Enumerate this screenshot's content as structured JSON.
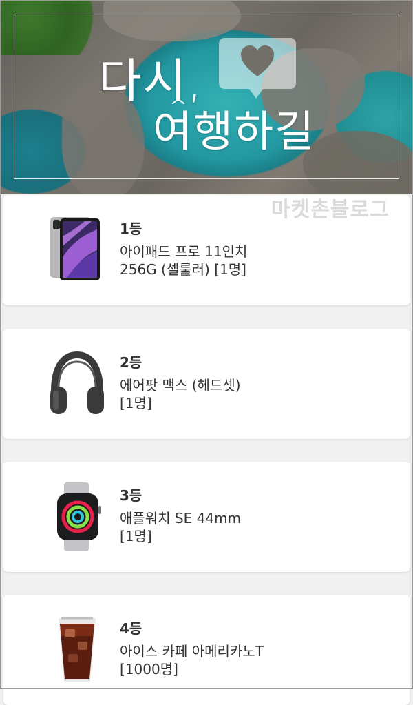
{
  "banner": {
    "title_line1": "다시,",
    "title_line2": "여행하길",
    "watermark": "마켓촌블로그"
  },
  "prizes": [
    {
      "rank": "1등",
      "name": "아이패드 프로 11인치",
      "detail": "256G (셀룰러) [1명]",
      "icon": "ipad-pro-icon"
    },
    {
      "rank": "2등",
      "name": "에어팟 맥스 (헤드셋)",
      "detail": "[1명]",
      "icon": "airpods-max-icon"
    },
    {
      "rank": "3등",
      "name": "애플워치 SE 44mm",
      "detail": "[1명]",
      "icon": "apple-watch-icon"
    },
    {
      "rank": "4등",
      "name": "아이스 카페 아메리카노T",
      "detail": "[1000명]",
      "icon": "iced-americano-icon"
    }
  ]
}
